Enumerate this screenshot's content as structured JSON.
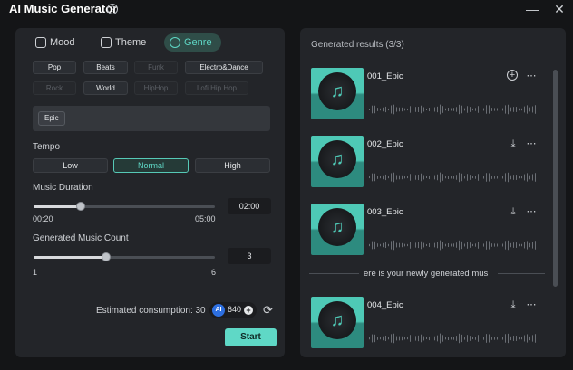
{
  "app": {
    "title": "AI Music Generator"
  },
  "tabs": [
    {
      "label": "Mood",
      "icon": "mood-icon"
    },
    {
      "label": "Theme",
      "icon": "theme-icon"
    },
    {
      "label": "Genre",
      "icon": "genre-icon",
      "active": true
    }
  ],
  "genres": [
    {
      "label": "Pop",
      "enabled": true
    },
    {
      "label": "Beats",
      "enabled": true
    },
    {
      "label": "Funk",
      "enabled": false
    },
    {
      "label": "Electro&Dance",
      "enabled": true
    },
    {
      "label": "Rock",
      "enabled": false
    },
    {
      "label": "World",
      "enabled": true
    },
    {
      "label": "HipHop",
      "enabled": false
    },
    {
      "label": "Lofi Hip Hop",
      "enabled": false
    }
  ],
  "selected": {
    "tag": "Epic"
  },
  "tempo": {
    "label": "Tempo",
    "options": [
      "Low",
      "Normal",
      "High"
    ],
    "selected": "Normal"
  },
  "duration": {
    "label": "Music Duration",
    "min_label": "00:20",
    "max_label": "05:00",
    "value": "02:00",
    "fraction": 0.26
  },
  "count": {
    "label": "Generated Music Count",
    "min_label": "1",
    "max_label": "6",
    "value": "3",
    "fraction": 0.4
  },
  "consumption": {
    "label": "Estimated consumption: 30",
    "ai_badge": "AI",
    "credits": "640"
  },
  "start_label": "Start",
  "results": {
    "title": "Generated results (3/3)",
    "items": [
      {
        "name": "001_Epic",
        "action_icon": "add-icon"
      },
      {
        "name": "002_Epic",
        "action_icon": "download-icon"
      },
      {
        "name": "003_Epic",
        "action_icon": "download-icon"
      },
      {
        "name": "004_Epic",
        "action_icon": "download-icon"
      }
    ],
    "divider_text": "ere is your newly generated mus"
  },
  "colors": {
    "accent": "#5fd8c6",
    "panel": "#232529",
    "background": "#141517",
    "cover": "#4ec9b6"
  }
}
